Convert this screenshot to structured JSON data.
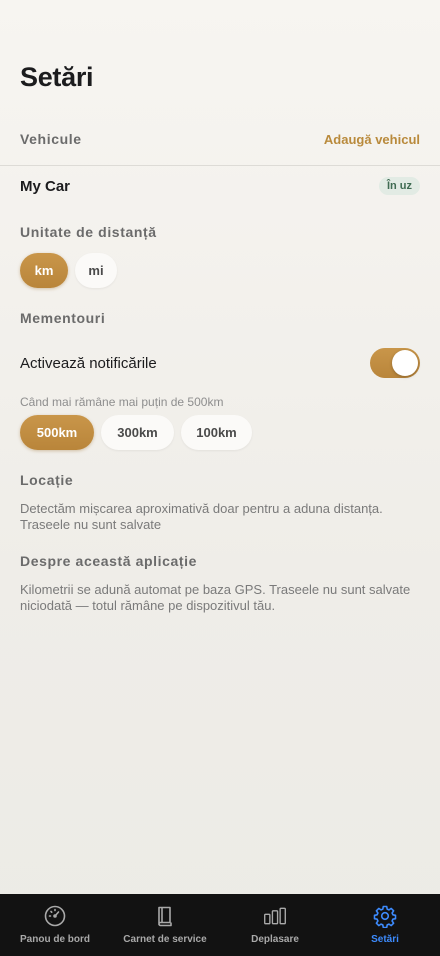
{
  "header": {
    "title": "Setări"
  },
  "vehicles": {
    "section_label": "Vehicule",
    "add_label": "Adaugă vehicul",
    "items": [
      {
        "name": "My Car",
        "badge": "În uz"
      }
    ]
  },
  "distance_unit": {
    "section_label": "Unitate de distanță",
    "options": [
      "km",
      "mi"
    ],
    "selected": "km"
  },
  "reminders": {
    "section_label": "Mementouri",
    "notifications_label": "Activează notificările",
    "notifications_enabled": true,
    "threshold_hint": "Când mai rămâne mai puțin de 500km",
    "thresholds": [
      "500km",
      "300km",
      "100km"
    ],
    "selected_threshold": "500km"
  },
  "location": {
    "section_label": "Locație",
    "text": "Detectăm mișcarea aproximativă doar pentru a aduna distanța. Traseele nu sunt salvate"
  },
  "about": {
    "section_label": "Despre această aplicație",
    "text": "Kilometrii se adună automat pe baza GPS. Traseele nu sunt salvate niciodată — totul rămâne pe dispozitivul tău."
  },
  "tabbar": {
    "tabs": [
      {
        "label": "Panou de bord",
        "icon": "gauge-icon"
      },
      {
        "label": "Carnet de service",
        "icon": "book-icon"
      },
      {
        "label": "Deplasare",
        "icon": "bar-chart-icon"
      },
      {
        "label": "Setări",
        "icon": "gear-icon"
      }
    ],
    "active_index": 3
  },
  "colors": {
    "accent": "#b98a3c",
    "badge_bg": "#e2ebe4",
    "badge_text": "#3f6b52",
    "tab_active": "#3d8bfd",
    "tabbar_bg": "#121212"
  }
}
